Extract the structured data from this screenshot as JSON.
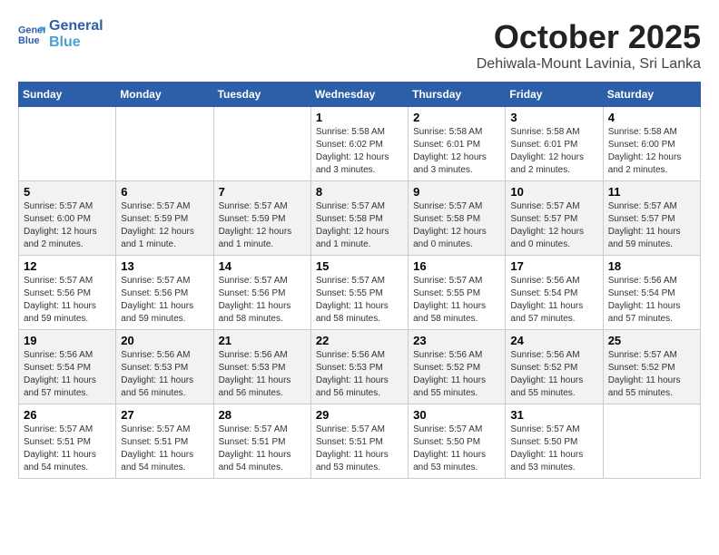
{
  "logo": {
    "line1": "General",
    "line2": "Blue"
  },
  "header": {
    "month": "October 2025",
    "location": "Dehiwala-Mount Lavinia, Sri Lanka"
  },
  "weekdays": [
    "Sunday",
    "Monday",
    "Tuesday",
    "Wednesday",
    "Thursday",
    "Friday",
    "Saturday"
  ],
  "weeks": [
    [
      {
        "day": "",
        "info": ""
      },
      {
        "day": "",
        "info": ""
      },
      {
        "day": "",
        "info": ""
      },
      {
        "day": "1",
        "info": "Sunrise: 5:58 AM\nSunset: 6:02 PM\nDaylight: 12 hours\nand 3 minutes."
      },
      {
        "day": "2",
        "info": "Sunrise: 5:58 AM\nSunset: 6:01 PM\nDaylight: 12 hours\nand 3 minutes."
      },
      {
        "day": "3",
        "info": "Sunrise: 5:58 AM\nSunset: 6:01 PM\nDaylight: 12 hours\nand 2 minutes."
      },
      {
        "day": "4",
        "info": "Sunrise: 5:58 AM\nSunset: 6:00 PM\nDaylight: 12 hours\nand 2 minutes."
      }
    ],
    [
      {
        "day": "5",
        "info": "Sunrise: 5:57 AM\nSunset: 6:00 PM\nDaylight: 12 hours\nand 2 minutes."
      },
      {
        "day": "6",
        "info": "Sunrise: 5:57 AM\nSunset: 5:59 PM\nDaylight: 12 hours\nand 1 minute."
      },
      {
        "day": "7",
        "info": "Sunrise: 5:57 AM\nSunset: 5:59 PM\nDaylight: 12 hours\nand 1 minute."
      },
      {
        "day": "8",
        "info": "Sunrise: 5:57 AM\nSunset: 5:58 PM\nDaylight: 12 hours\nand 1 minute."
      },
      {
        "day": "9",
        "info": "Sunrise: 5:57 AM\nSunset: 5:58 PM\nDaylight: 12 hours\nand 0 minutes."
      },
      {
        "day": "10",
        "info": "Sunrise: 5:57 AM\nSunset: 5:57 PM\nDaylight: 12 hours\nand 0 minutes."
      },
      {
        "day": "11",
        "info": "Sunrise: 5:57 AM\nSunset: 5:57 PM\nDaylight: 11 hours\nand 59 minutes."
      }
    ],
    [
      {
        "day": "12",
        "info": "Sunrise: 5:57 AM\nSunset: 5:56 PM\nDaylight: 11 hours\nand 59 minutes."
      },
      {
        "day": "13",
        "info": "Sunrise: 5:57 AM\nSunset: 5:56 PM\nDaylight: 11 hours\nand 59 minutes."
      },
      {
        "day": "14",
        "info": "Sunrise: 5:57 AM\nSunset: 5:56 PM\nDaylight: 11 hours\nand 58 minutes."
      },
      {
        "day": "15",
        "info": "Sunrise: 5:57 AM\nSunset: 5:55 PM\nDaylight: 11 hours\nand 58 minutes."
      },
      {
        "day": "16",
        "info": "Sunrise: 5:57 AM\nSunset: 5:55 PM\nDaylight: 11 hours\nand 58 minutes."
      },
      {
        "day": "17",
        "info": "Sunrise: 5:56 AM\nSunset: 5:54 PM\nDaylight: 11 hours\nand 57 minutes."
      },
      {
        "day": "18",
        "info": "Sunrise: 5:56 AM\nSunset: 5:54 PM\nDaylight: 11 hours\nand 57 minutes."
      }
    ],
    [
      {
        "day": "19",
        "info": "Sunrise: 5:56 AM\nSunset: 5:54 PM\nDaylight: 11 hours\nand 57 minutes."
      },
      {
        "day": "20",
        "info": "Sunrise: 5:56 AM\nSunset: 5:53 PM\nDaylight: 11 hours\nand 56 minutes."
      },
      {
        "day": "21",
        "info": "Sunrise: 5:56 AM\nSunset: 5:53 PM\nDaylight: 11 hours\nand 56 minutes."
      },
      {
        "day": "22",
        "info": "Sunrise: 5:56 AM\nSunset: 5:53 PM\nDaylight: 11 hours\nand 56 minutes."
      },
      {
        "day": "23",
        "info": "Sunrise: 5:56 AM\nSunset: 5:52 PM\nDaylight: 11 hours\nand 55 minutes."
      },
      {
        "day": "24",
        "info": "Sunrise: 5:56 AM\nSunset: 5:52 PM\nDaylight: 11 hours\nand 55 minutes."
      },
      {
        "day": "25",
        "info": "Sunrise: 5:57 AM\nSunset: 5:52 PM\nDaylight: 11 hours\nand 55 minutes."
      }
    ],
    [
      {
        "day": "26",
        "info": "Sunrise: 5:57 AM\nSunset: 5:51 PM\nDaylight: 11 hours\nand 54 minutes."
      },
      {
        "day": "27",
        "info": "Sunrise: 5:57 AM\nSunset: 5:51 PM\nDaylight: 11 hours\nand 54 minutes."
      },
      {
        "day": "28",
        "info": "Sunrise: 5:57 AM\nSunset: 5:51 PM\nDaylight: 11 hours\nand 54 minutes."
      },
      {
        "day": "29",
        "info": "Sunrise: 5:57 AM\nSunset: 5:51 PM\nDaylight: 11 hours\nand 53 minutes."
      },
      {
        "day": "30",
        "info": "Sunrise: 5:57 AM\nSunset: 5:50 PM\nDaylight: 11 hours\nand 53 minutes."
      },
      {
        "day": "31",
        "info": "Sunrise: 5:57 AM\nSunset: 5:50 PM\nDaylight: 11 hours\nand 53 minutes."
      },
      {
        "day": "",
        "info": ""
      }
    ]
  ]
}
